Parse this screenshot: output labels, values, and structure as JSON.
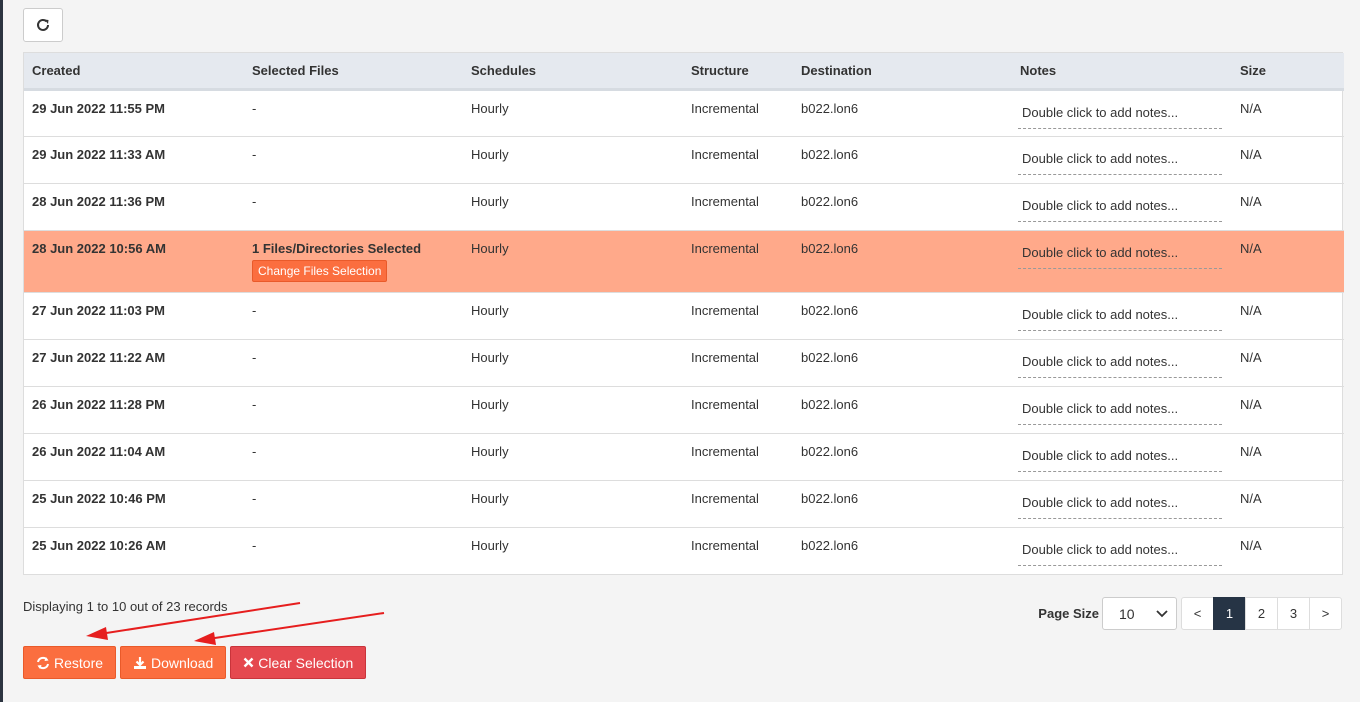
{
  "toolbar": {
    "refresh_icon": "refresh-icon"
  },
  "table": {
    "headers": [
      "Created",
      "Selected Files",
      "Schedules",
      "Structure",
      "Destination",
      "Notes",
      "Size"
    ],
    "rows": [
      {
        "created": "29 Jun 2022 11:55 PM",
        "files": "-",
        "schedule": "Hourly",
        "structure": "Incremental",
        "destination": "b022.lon6",
        "notes": "Double click to add notes...",
        "size": "N/A"
      },
      {
        "created": "29 Jun 2022 11:33 AM",
        "files": "-",
        "schedule": "Hourly",
        "structure": "Incremental",
        "destination": "b022.lon6",
        "notes": "Double click to add notes...",
        "size": "N/A"
      },
      {
        "created": "28 Jun 2022 11:36 PM",
        "files": "-",
        "schedule": "Hourly",
        "structure": "Incremental",
        "destination": "b022.lon6",
        "notes": "Double click to add notes...",
        "size": "N/A"
      },
      {
        "created": "28 Jun 2022 10:56 AM",
        "files": "1 Files/Directories Selected",
        "change_label": "Change Files Selection",
        "schedule": "Hourly",
        "structure": "Incremental",
        "destination": "b022.lon6",
        "notes": "Double click to add notes...",
        "size": "N/A"
      },
      {
        "created": "27 Jun 2022 11:03 PM",
        "files": "-",
        "schedule": "Hourly",
        "structure": "Incremental",
        "destination": "b022.lon6",
        "notes": "Double click to add notes...",
        "size": "N/A"
      },
      {
        "created": "27 Jun 2022 11:22 AM",
        "files": "-",
        "schedule": "Hourly",
        "structure": "Incremental",
        "destination": "b022.lon6",
        "notes": "Double click to add notes...",
        "size": "N/A"
      },
      {
        "created": "26 Jun 2022 11:28 PM",
        "files": "-",
        "schedule": "Hourly",
        "structure": "Incremental",
        "destination": "b022.lon6",
        "notes": "Double click to add notes...",
        "size": "N/A"
      },
      {
        "created": "26 Jun 2022 11:04 AM",
        "files": "-",
        "schedule": "Hourly",
        "structure": "Incremental",
        "destination": "b022.lon6",
        "notes": "Double click to add notes...",
        "size": "N/A"
      },
      {
        "created": "25 Jun 2022 10:46 PM",
        "files": "-",
        "schedule": "Hourly",
        "structure": "Incremental",
        "destination": "b022.lon6",
        "notes": "Double click to add notes...",
        "size": "N/A"
      },
      {
        "created": "25 Jun 2022 10:26 AM",
        "files": "-",
        "schedule": "Hourly",
        "structure": "Incremental",
        "destination": "b022.lon6",
        "notes": "Double click to add notes...",
        "size": "N/A"
      }
    ]
  },
  "footer": {
    "status": "Displaying 1 to 10 out of 23 records",
    "page_size_label": "Page Size",
    "page_size_value": "10",
    "pages": [
      "<",
      "1",
      "2",
      "3",
      ">"
    ],
    "active_page": "1"
  },
  "actions": {
    "restore": "Restore",
    "download": "Download",
    "clear": "Clear Selection"
  },
  "colors": {
    "selected_row": "#ffa98a",
    "primary_orange": "#fb6e3f",
    "danger_red": "#e5484f",
    "active_page": "#263445"
  }
}
